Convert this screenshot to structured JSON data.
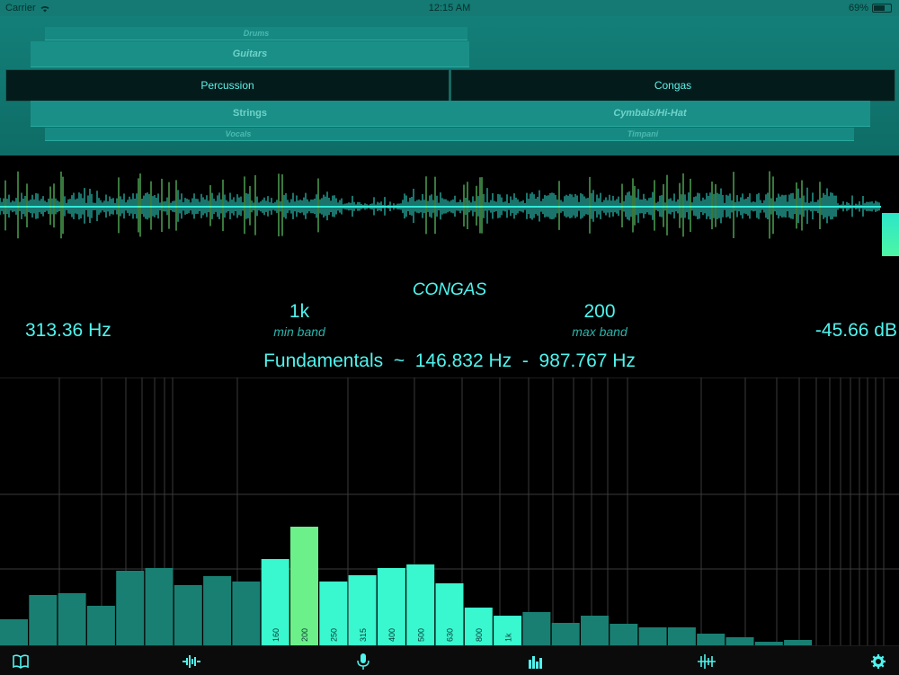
{
  "status_bar": {
    "carrier": "Carrier",
    "time": "12:15 AM",
    "battery": "69%"
  },
  "picker": {
    "left_wheel": {
      "above2": "Drums",
      "above1": "Guitars",
      "selected": "Percussion",
      "below1": "Strings",
      "below2": "Vocals"
    },
    "right_wheel": {
      "selected": "Congas",
      "below1": "Cymbals/Hi-Hat",
      "below2": "Timpani"
    }
  },
  "analyzer": {
    "instrument_name": "CONGAS",
    "current_frequency": "313.36 Hz",
    "level_db": "-45.66 dB",
    "min_band": {
      "value": "1k",
      "label": "min band"
    },
    "max_band": {
      "value": "200",
      "label": "max band"
    },
    "fundamentals_label": "Fundamentals",
    "fundamentals_separator": "~",
    "fundamentals_low": "146.832 Hz",
    "fundamentals_dash": "-",
    "fundamentals_high": "987.767 Hz"
  },
  "chart_data": {
    "type": "bar",
    "band_labels": [
      "",
      "",
      "",
      "",
      "",
      "",
      "",
      "",
      "",
      "160",
      "200",
      "250",
      "315",
      "400",
      "500",
      "630",
      "800",
      "1k",
      "",
      "",
      "",
      "",
      "",
      "",
      "",
      "",
      "",
      "",
      ""
    ],
    "values": [
      29,
      56,
      58,
      44,
      83,
      86,
      67,
      77,
      71,
      96,
      132,
      71,
      78,
      86,
      90,
      69,
      42,
      33,
      37,
      25,
      33,
      24,
      20,
      20,
      13,
      9,
      4,
      6,
      0
    ],
    "highlight_range": [
      9,
      17
    ],
    "colors": {
      "dim": "#1a7f73",
      "highlight": "#39f7cf",
      "peak": "#6cf08a"
    }
  },
  "tab_bar": {
    "items": [
      {
        "icon": "book-icon"
      },
      {
        "icon": "waveform-icon"
      },
      {
        "icon": "microphone-icon"
      },
      {
        "icon": "spectrum-icon"
      },
      {
        "icon": "filter-icon"
      },
      {
        "icon": "gear-icon"
      }
    ]
  },
  "colors": {
    "accent": "#4ff4ee",
    "picker_bg": "#137f78",
    "background": "#000000"
  }
}
